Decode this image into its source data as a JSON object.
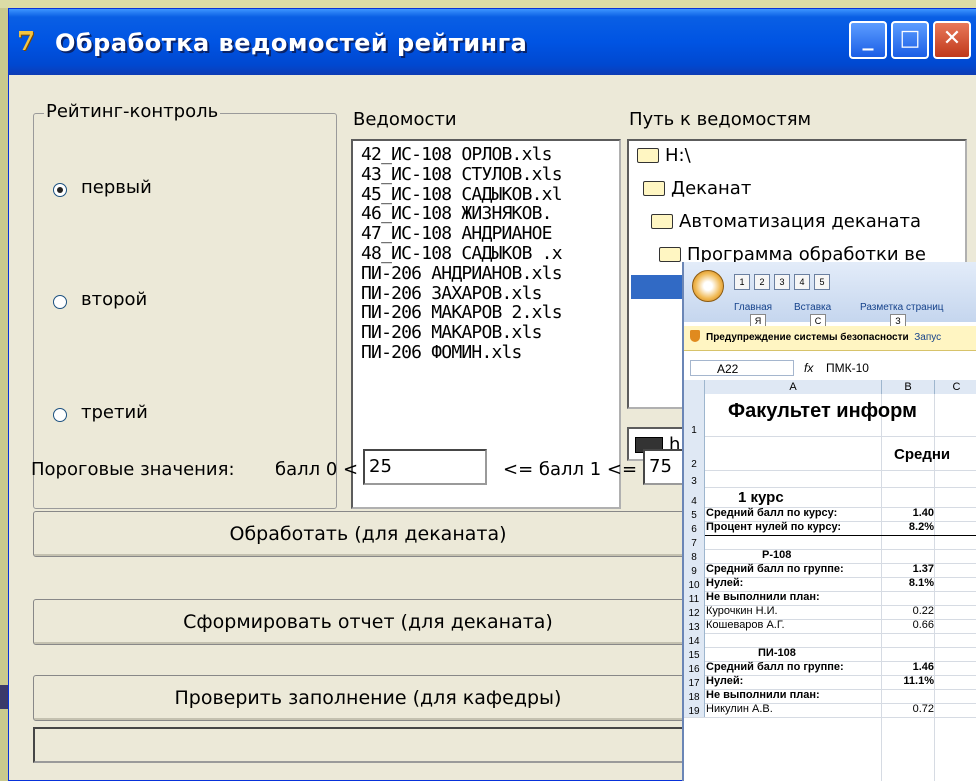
{
  "window": {
    "title": "Обработка ведомостей рейтинга",
    "buttons": {
      "minimize": "_",
      "maximize": "□",
      "close": "✕"
    }
  },
  "rating": {
    "group_title": "Рейтинг-контроль",
    "options": [
      {
        "label": "первый",
        "selected": true
      },
      {
        "label": "второй",
        "selected": false
      },
      {
        "label": "третий",
        "selected": false
      }
    ]
  },
  "sheets": {
    "label": "Ведомости",
    "items": [
      "42_ИС-108 ОРЛОВ.xls",
      "43_ИС-108 СТУЛОВ.xls",
      "45_ИС-108 САДЫКОВ.xl",
      "46_ИС-108 ЖИЗНЯКОВ.",
      "47_ИС-108 АНДРИАНОЕ",
      "48_ИС-108 САДЫКОВ .x",
      "ПИ-206 АНДРИАНОВ.xls",
      "ПИ-206 ЗАХАРОВ.xls",
      "ПИ-206 МАКАРОВ 2.xls",
      "ПИ-206 МАКАРОВ.xls",
      "ПИ-206 ФОМИН.xls"
    ]
  },
  "path": {
    "label": "Путь к ведомостям",
    "nodes": [
      "H:\\",
      "Деканат",
      "Автоматизация деканата",
      "Программа обработки ве"
    ],
    "drive": "h"
  },
  "thresholds": {
    "label": "Пороговые значения:",
    "b0_label": "балл 0 <",
    "b0_value": "25",
    "b1_label": "<=  балл 1  <=",
    "b1_value": "75"
  },
  "actions": {
    "process": "Обработать (для деканата)",
    "report": "Сформировать отчет (для деканата)",
    "check": "Проверить заполнение (для кафедры)"
  },
  "excel": {
    "qa_keys": [
      "1",
      "2",
      "3",
      "4",
      "5"
    ],
    "tabs": [
      "Главная",
      "Вставка",
      "Разметка страниц"
    ],
    "tab_keys": [
      "Я",
      "С",
      "З"
    ],
    "security_warning": "Предупреждение системы безопасности",
    "run_text": "Запус",
    "cell_ref": "A22",
    "fx": "fx",
    "formula": "ПМК-10",
    "col_headers": [
      "A",
      "B",
      "C"
    ],
    "title": "Факультет информ",
    "subtitle": "Средни",
    "rows": [
      {
        "n": "1",
        "a": "",
        "b": ""
      },
      {
        "n": "2",
        "a": "",
        "b": ""
      },
      {
        "n": "3",
        "a": "",
        "b": ""
      },
      {
        "n": "4",
        "a": "1 курс",
        "b": ""
      },
      {
        "n": "5",
        "a": "Средний балл по курсу:",
        "b": "1.40"
      },
      {
        "n": "6",
        "a": "Процент нулей по курсу:",
        "b": "8.2%"
      },
      {
        "n": "7",
        "a": "",
        "b": ""
      },
      {
        "n": "8",
        "a": "Р-108",
        "b": ""
      },
      {
        "n": "9",
        "a": "Средний балл по группе:",
        "b": "1.37"
      },
      {
        "n": "10",
        "a": "Нулей:",
        "b": "8.1%"
      },
      {
        "n": "11",
        "a": "Не выполнили план:",
        "b": ""
      },
      {
        "n": "12",
        "a": "Курочкин Н.И.",
        "b": "0.22"
      },
      {
        "n": "13",
        "a": "Кошеваров А.Г.",
        "b": "0.66"
      },
      {
        "n": "14",
        "a": "",
        "b": ""
      },
      {
        "n": "15",
        "a": "ПИ-108",
        "b": ""
      },
      {
        "n": "16",
        "a": "Средний балл по группе:",
        "b": "1.46"
      },
      {
        "n": "17",
        "a": "Нулей:",
        "b": "11.1%"
      },
      {
        "n": "18",
        "a": "Не выполнили план:",
        "b": ""
      },
      {
        "n": "19",
        "a": "Никулин А.В.",
        "b": "0.72"
      }
    ]
  }
}
